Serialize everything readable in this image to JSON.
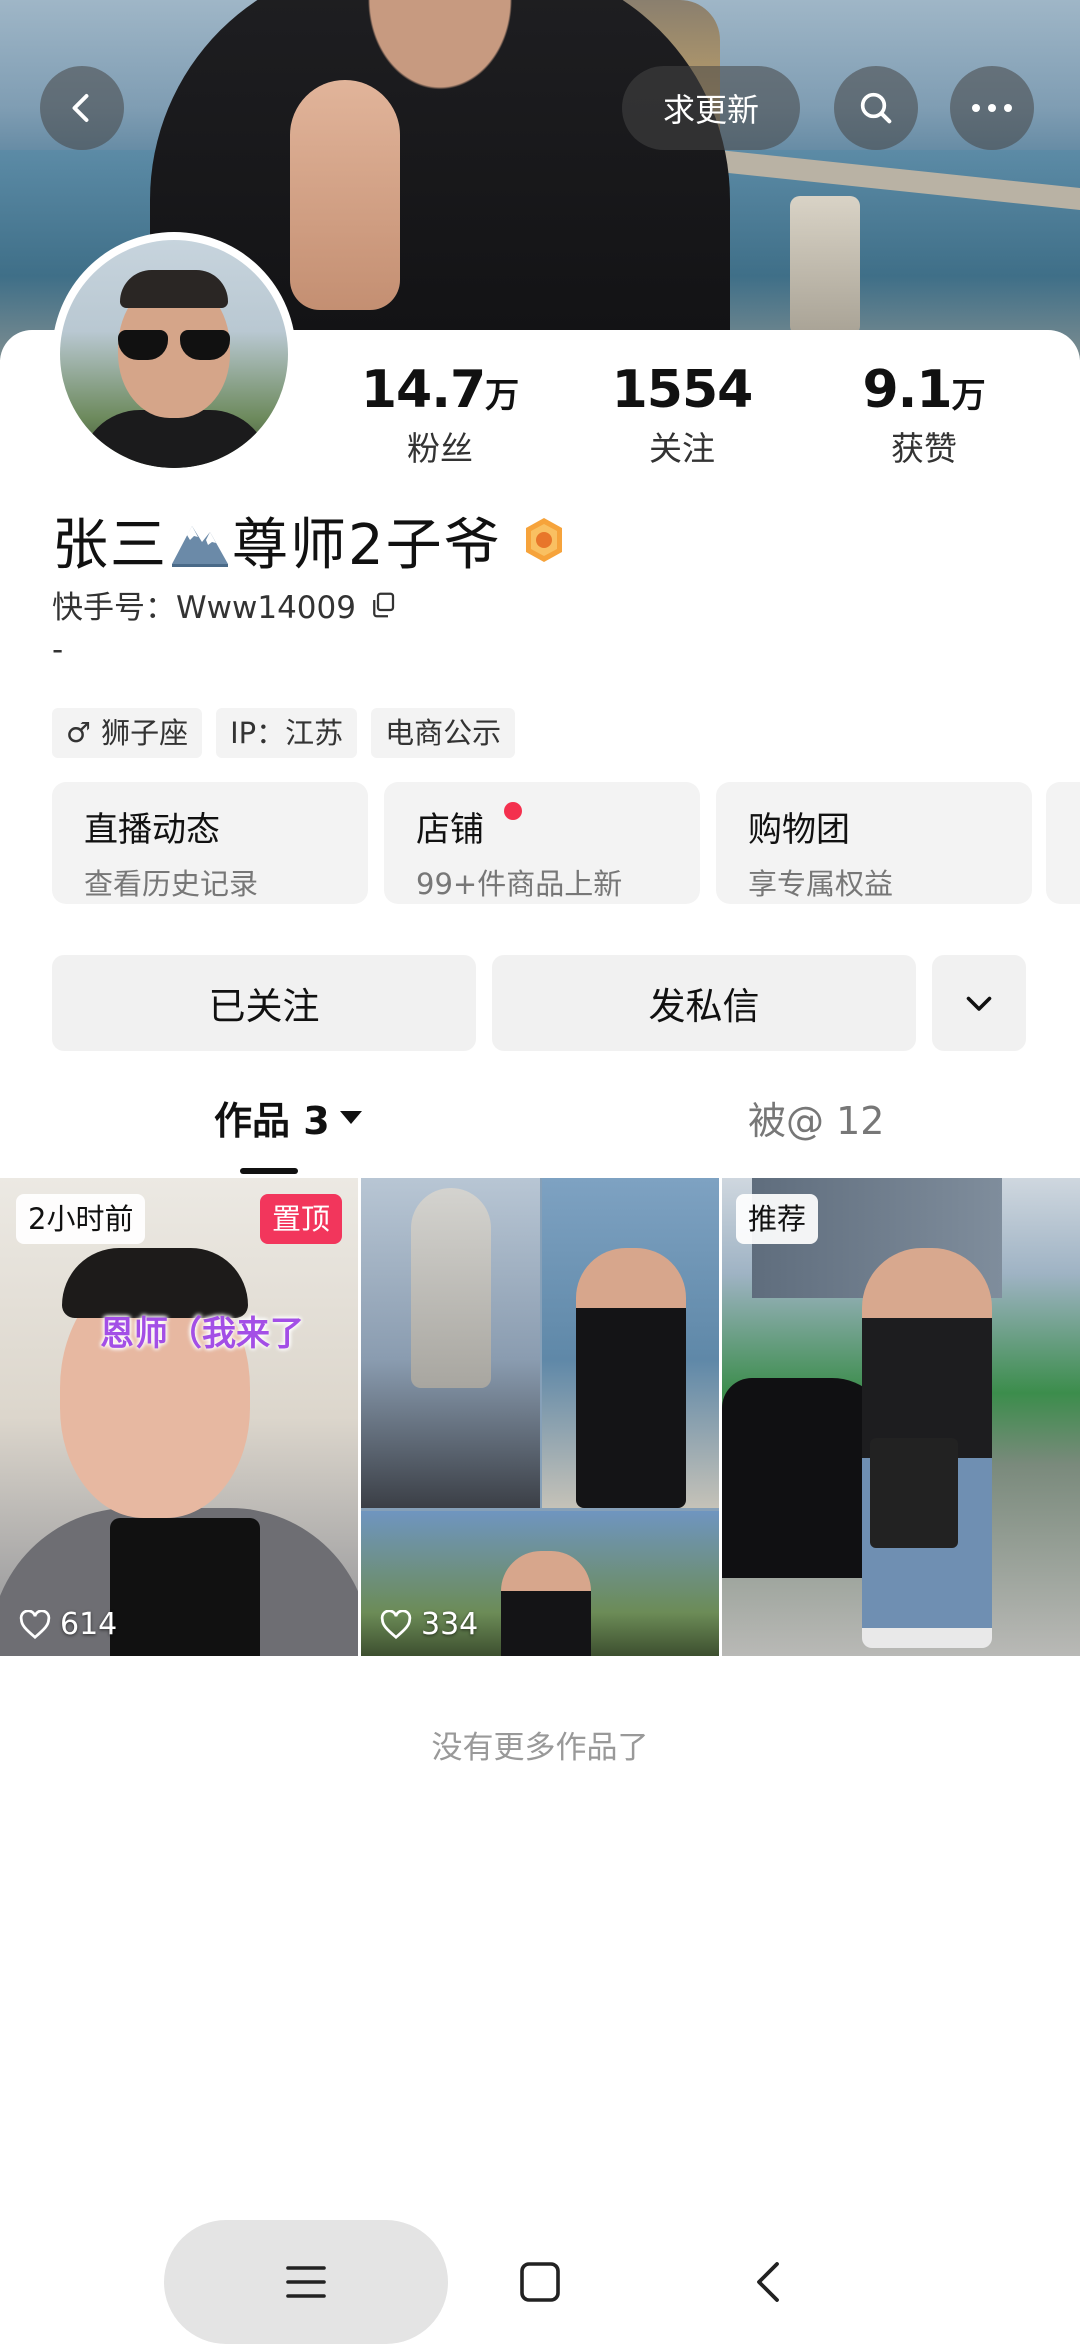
{
  "header": {
    "request_update_label": "求更新"
  },
  "profile": {
    "stats": [
      {
        "num": "14.7",
        "unit": "万",
        "label": "粉丝"
      },
      {
        "num": "1554",
        "unit": "",
        "label": "关注"
      },
      {
        "num": "9.1",
        "unit": "万",
        "label": "获赞"
      }
    ],
    "name_part1": "张三",
    "name_part2": "尊师2子爷",
    "kuaishou_id": "快手号：Www14009",
    "bio": "-",
    "tags": {
      "zodiac": "狮子座",
      "ip": "IP：江苏",
      "ecom": "电商公示",
      "gender_symbol": "♂"
    }
  },
  "tiles": [
    {
      "title": "直播动态",
      "sub": "查看历史记录"
    },
    {
      "title": "店铺",
      "sub": "99+件商品上新"
    },
    {
      "title": "购物团",
      "sub": "享专属权益"
    }
  ],
  "actions": {
    "follow_label": "已关注",
    "message_label": "发私信"
  },
  "tabs": {
    "works_label": "作品 3",
    "at_label": "被@ 12"
  },
  "videos": [
    {
      "badge_left": "2小时前",
      "badge_right": "置顶",
      "caption": "恩师（我来了",
      "likes": "614"
    },
    {
      "likes": "334"
    },
    {
      "badge_left": "推荐"
    }
  ],
  "footer": {
    "no_more": "没有更多作品了"
  },
  "colors": {
    "accent_pink": "#f2365c",
    "caption_purple": "#a34fe6"
  }
}
